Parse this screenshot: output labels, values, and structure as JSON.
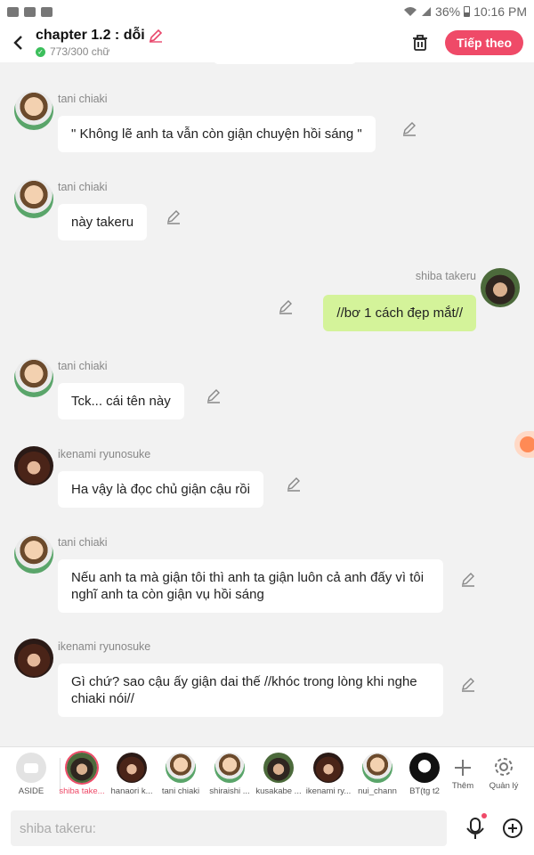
{
  "status_bar": {
    "battery": "36%",
    "time": "10:16 PM"
  },
  "header": {
    "title": "chapter 1.2 : dỗi",
    "word_count": "773/300 chữ",
    "continue_label": "Tiếp theo"
  },
  "messages": [
    {
      "sender": "tani chiaki",
      "text": "\" Không lẽ anh ta vẫn còn giận chuyện hồi sáng \""
    },
    {
      "sender": "tani chiaki",
      "text": "này takeru"
    },
    {
      "sender": "shiba takeru",
      "text": "//bơ 1 cách đẹp mắt//"
    },
    {
      "sender": "tani chiaki",
      "text": "Tck... cái tên này"
    },
    {
      "sender": "ikenami ryunosuke",
      "text": "Ha vậy là đọc chủ giận cậu rồi"
    },
    {
      "sender": "tani chiaki",
      "text": "Nếu anh ta mà giận tôi thì anh ta giận luôn cả anh đấy vì tôi nghĩ  anh ta còn giận vụ hồi sáng"
    },
    {
      "sender": "ikenami ryunosuke",
      "text": "Gì chứ? sao cậu ấy giận dai thế //khóc trong lòng khi nghe chiaki nói//"
    }
  ],
  "characters": [
    {
      "name": "ASIDE"
    },
    {
      "name": "shiba take..."
    },
    {
      "name": "hanaori k..."
    },
    {
      "name": "tani chiaki"
    },
    {
      "name": "shiraishi ..."
    },
    {
      "name": "kusakabe ..."
    },
    {
      "name": "ikenami ry..."
    },
    {
      "name": "nui_chann"
    },
    {
      "name": "BT(tg t2"
    },
    {
      "name": "Thêm"
    },
    {
      "name": "Quản lý"
    }
  ],
  "input": {
    "placeholder": "shiba takeru:"
  },
  "colors": {
    "accent": "#ef4a68",
    "my_bubble": "#d4f39a",
    "background": "#f2f2f2"
  }
}
